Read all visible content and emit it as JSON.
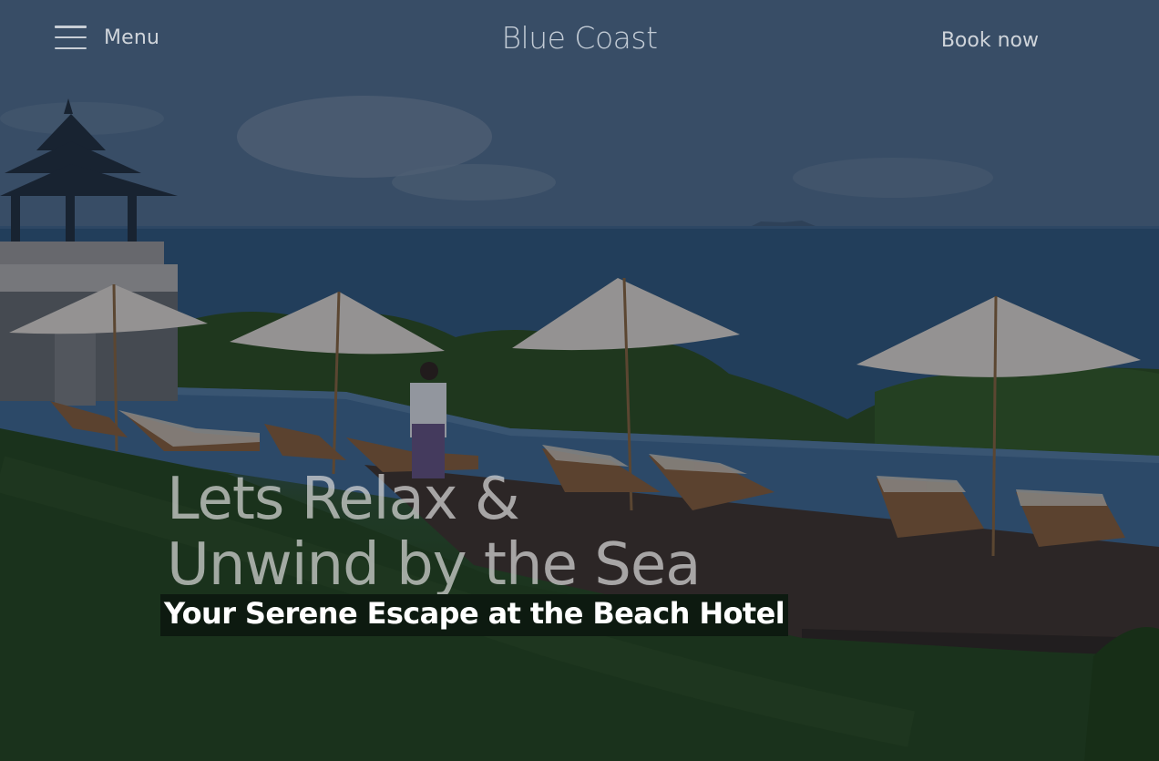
{
  "header": {
    "menu_label": "Menu",
    "brand": "Blue Coast",
    "book_now_label": "Book now",
    "menu_icon": "hamburger-menu-icon"
  },
  "hero": {
    "headline_line1": "Lets Relax &",
    "headline_line2": "Unwind by the Sea",
    "subheadline": "Your Serene Escape at the Beach Hotel",
    "background_description_colors": {
      "sky": "#4c6684",
      "sea": "#2f5275",
      "foliage": "#2a4a2c",
      "lawn": "#22421f"
    }
  }
}
